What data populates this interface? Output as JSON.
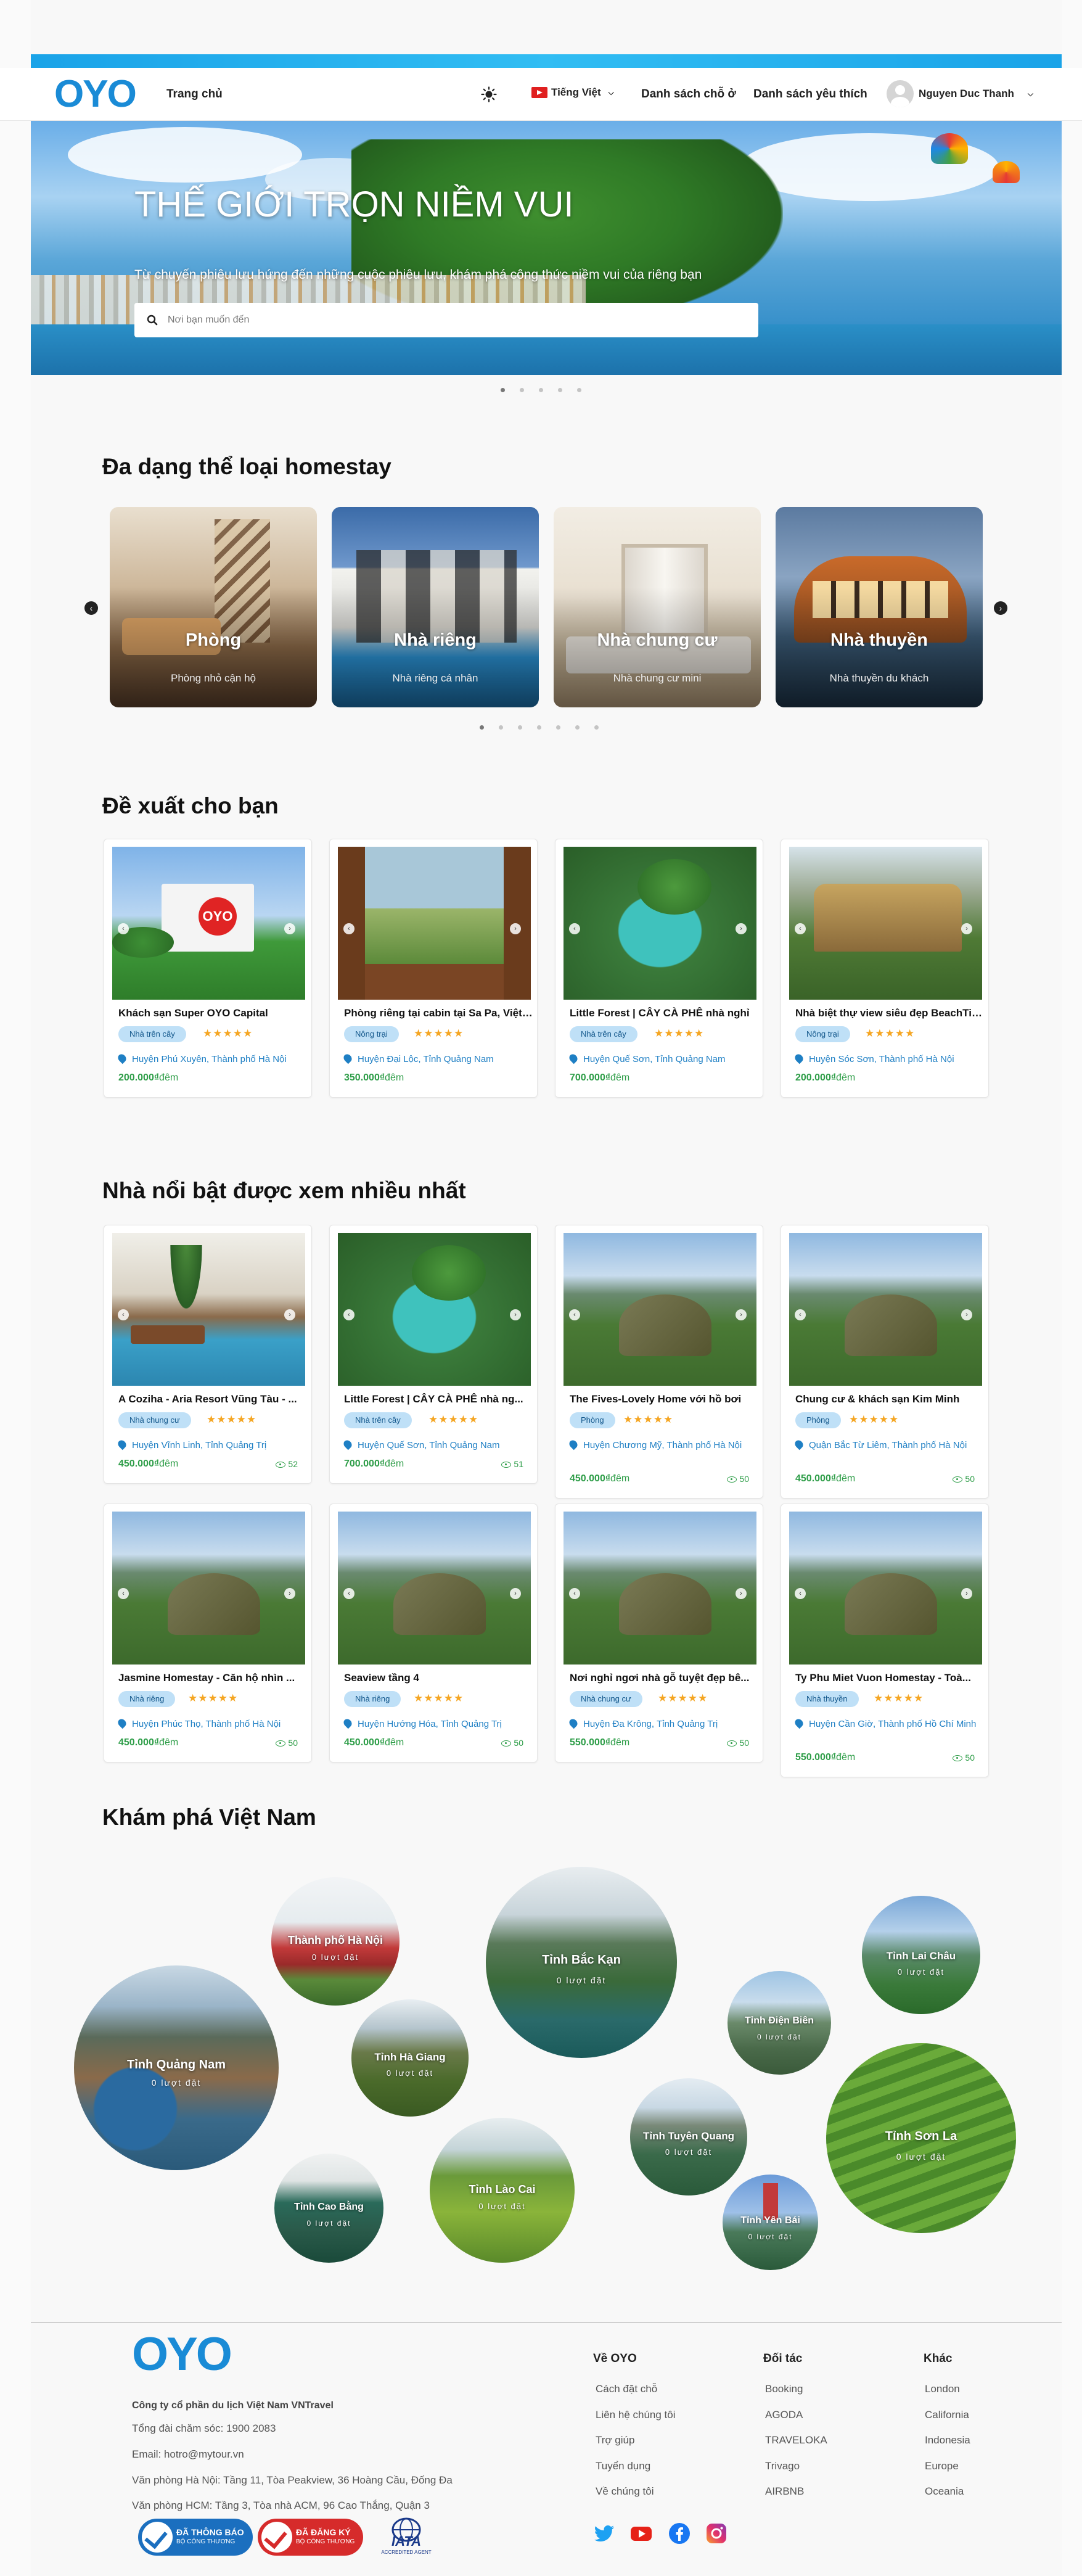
{
  "header": {
    "logo": "OYO",
    "home": "Trang chủ",
    "language": "Tiếng Việt",
    "nav_places": "Danh sách chỗ ở",
    "nav_favorites": "Danh sách yêu thích",
    "user_name": "Nguyen Duc Thanh"
  },
  "hero": {
    "title": "THẾ GIỚI TRỌN NIỀM VUI",
    "subtitle": "Từ chuyến phiêu lưu hứng đến những cuộc phiêu lưu, khám phá công thức niềm vui của riêng bạn",
    "search_placeholder": "Nơi bạn muốn đến"
  },
  "categories": {
    "title": "Đa dạng thể loại homestay",
    "items": [
      {
        "name": "Phòng",
        "desc": "Phòng nhỏ cận hộ"
      },
      {
        "name": "Nhà riêng",
        "desc": "Nhà riêng cá nhân"
      },
      {
        "name": "Nhà chung cư",
        "desc": "Nhà chung cư mini"
      },
      {
        "name": "Nhà thuyền",
        "desc": "Nhà thuyền du khách"
      }
    ]
  },
  "suggest": {
    "title": "Đề xuất cho bạn",
    "items": [
      {
        "name": "Khách sạn Super OYO Capital",
        "tag": "Nhà trên cây",
        "location": "Huyện Phú Xuyên, Thành phố Hà Nội",
        "price": "200.000₫",
        "unit": "đêm"
      },
      {
        "name": "Phòng riêng tại cabin tại Sa Pa, Việt Nam",
        "tag": "Nông trại",
        "location": "Huyện Đại Lộc, Tỉnh Quảng Nam",
        "price": "350.000₫",
        "unit": "đêm"
      },
      {
        "name": "Little Forest | CÂY CÀ PHÊ nhà nghỉ",
        "tag": "Nhà trên cây",
        "location": "Huyện Quế Sơn, Tỉnh Quảng Nam",
        "price": "700.000₫",
        "unit": "đêm"
      },
      {
        "name": "Nhà biệt thự view siêu đẹp BeachTime",
        "tag": "Nông trại",
        "location": "Huyện Sóc Sơn, Thành phố Hà Nội",
        "price": "200.000₫",
        "unit": "đêm"
      }
    ]
  },
  "featured": {
    "title": "Nhà nổi bật được xem nhiều nhất",
    "items": [
      {
        "name": "A Coziha - Aria Resort Vũng Tàu - ...",
        "tag": "Nhà chung cư",
        "location": "Huyện Vĩnh Linh, Tỉnh Quảng Trị",
        "price": "450.000₫",
        "unit": "đêm",
        "views": "52"
      },
      {
        "name": "Little Forest | CÂY CÀ PHÊ nhà ng...",
        "tag": "Nhà trên cây",
        "location": "Huyện Quế Sơn, Tỉnh Quảng Nam",
        "price": "700.000₫",
        "unit": "đêm",
        "views": "51"
      },
      {
        "name": "The Fives-Lovely Home với hồ bơi",
        "tag": "Phòng",
        "location": "Huyện Chương Mỹ, Thành phố Hà Nội",
        "price": "450.000₫",
        "unit": "đêm",
        "views": "50"
      },
      {
        "name": "Chung cư & khách sạn Kim Minh",
        "tag": "Phòng",
        "location": "Quận Bắc Từ Liêm, Thành phố Hà Nội",
        "price": "450.000₫",
        "unit": "đêm",
        "views": "50"
      },
      {
        "name": "Jasmine Homestay - Căn hộ nhìn ...",
        "tag": "Nhà riêng",
        "location": "Huyện Phúc Thọ, Thành phố Hà Nội",
        "price": "450.000₫",
        "unit": "đêm",
        "views": "50"
      },
      {
        "name": "Seaview tầng 4",
        "tag": "Nhà riêng",
        "location": "Huyện Hướng Hóa, Tỉnh Quảng Trị",
        "price": "450.000₫",
        "unit": "đêm",
        "views": "50"
      },
      {
        "name": "Nơi nghỉ ngơi nhà gỗ tuyệt đẹp bê...",
        "tag": "Nhà chung cư",
        "location": "Huyện Đa Krông, Tỉnh Quảng Trị",
        "price": "550.000₫",
        "unit": "đêm",
        "views": "50"
      },
      {
        "name": "Ty Phu Miet Vuon Homestay - Toà...",
        "tag": "Nhà thuyền",
        "location": "Huyện Cần Giờ, Thành phố Hồ Chí Minh",
        "price": "550.000₫",
        "unit": "đêm",
        "views": "50"
      }
    ]
  },
  "explore": {
    "title": "Khám phá Việt Nam",
    "places": [
      {
        "name": "Thành phố Hà Nội",
        "count": "0 lượt đặt"
      },
      {
        "name": "Tỉnh Quảng Nam",
        "count": "0 lượt đặt"
      },
      {
        "name": "Tỉnh Hà Giang",
        "count": "0 lượt đặt"
      },
      {
        "name": "Tỉnh Bắc Kạn",
        "count": "0 lượt đặt"
      },
      {
        "name": "Tỉnh Điện Biên",
        "count": "0 lượt đặt"
      },
      {
        "name": "Tỉnh Lai Châu",
        "count": "0 lượt đặt"
      },
      {
        "name": "Tỉnh Cao Bằng",
        "count": "0 lượt đặt"
      },
      {
        "name": "Tỉnh Lào Cai",
        "count": "0 lượt đặt"
      },
      {
        "name": "Tỉnh Tuyên Quang",
        "count": "0 lượt đặt"
      },
      {
        "name": "Tỉnh Sơn La",
        "count": "0 lượt đặt"
      },
      {
        "name": "Tỉnh Yên Bái",
        "count": "0 lượt đặt"
      }
    ]
  },
  "footer": {
    "logo": "OYO",
    "company": "Công ty cổ phần du lịch Việt Nam VNTravel",
    "hotline": "Tổng đài chăm sóc: 1900 2083",
    "email": "Email: hotro@mytour.vn",
    "office_hn": "Văn phòng Hà Nội: Tầng 11, Tòa Peakview, 36 Hoàng Cầu, Đống Đa",
    "office_hcm": "Văn phòng HCM: Tầng 3, Tòa nhà ACM, 96 Cao Thắng, Quận 3",
    "col_about": {
      "title": "Về OYO",
      "items": [
        "Cách đặt chỗ",
        "Liên hệ chúng tôi",
        "Trợ giúp",
        "Tuyển dụng",
        "Về chúng tôi"
      ]
    },
    "col_partner": {
      "title": "Đối tác",
      "items": [
        "Booking",
        "AGODA",
        "TRAVELOKA",
        "Trivago",
        "AIRBNB"
      ]
    },
    "col_other": {
      "title": "Khác",
      "items": [
        "London",
        "California",
        "Indonesia",
        "Europe",
        "Oceania"
      ]
    },
    "badge_1": {
      "line1": "ĐÃ THÔNG BÁO",
      "line2": "BỘ CÔNG THƯƠNG"
    },
    "badge_2": {
      "line1": "ĐÃ ĐĂNG KÝ",
      "line2": "BỘ CÔNG THƯƠNG"
    },
    "iata": {
      "name": "IATA",
      "caption": "ACCREDITED AGENT"
    }
  },
  "colors": {
    "brand": "#1a8bd6",
    "price": "#2e9d48",
    "tag_bg": "#bfe0f7",
    "star": "#f5a623"
  }
}
